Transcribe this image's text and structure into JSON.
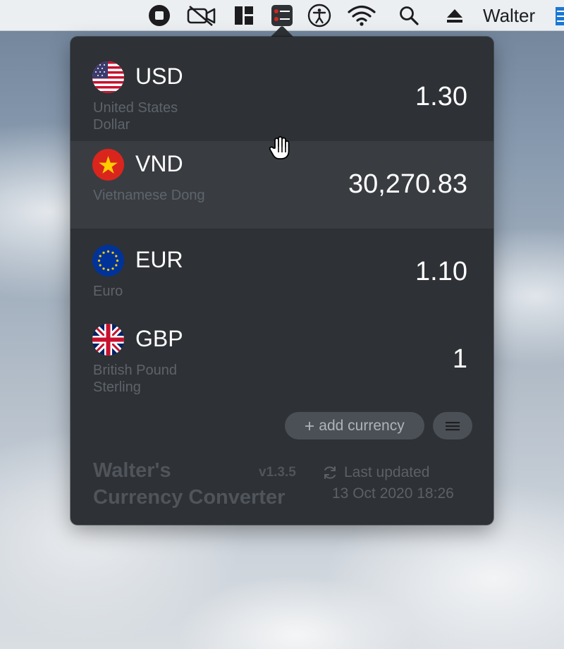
{
  "menubar": {
    "user_name": "Walter",
    "icons": [
      "stop-recording-icon",
      "video-off-icon",
      "window-layout-icon",
      "currency-converter-app-icon",
      "accessibility-icon",
      "wifi-icon",
      "spotlight-search-icon",
      "eject-icon"
    ]
  },
  "converter": {
    "currencies": [
      {
        "code": "USD",
        "name": "United States Dollar",
        "value": "1.30",
        "flag": "us-flag-icon",
        "highlighted": false
      },
      {
        "code": "VND",
        "name": "Vietnamese Dong",
        "value": "30,270.83",
        "flag": "vietnam-flag-icon",
        "highlighted": true
      },
      {
        "code": "EUR",
        "name": "Euro",
        "value": "1.10",
        "flag": "eu-flag-icon",
        "highlighted": false
      },
      {
        "code": "GBP",
        "name": "British Pound Sterling",
        "value": "1",
        "flag": "uk-flag-icon",
        "highlighted": false
      }
    ],
    "add_currency_label": "add currency",
    "app_title_line1": "Walter's",
    "app_title_line2": "Currency Converter",
    "version": "v1.3.5",
    "last_updated_label": "Last updated",
    "last_updated_time": "13 Oct 2020 18:26"
  },
  "colors": {
    "panel_bg": "#2e3135",
    "row_highlight": "#393d42",
    "muted_text": "#5e646b",
    "button_bg": "#4b5056"
  }
}
